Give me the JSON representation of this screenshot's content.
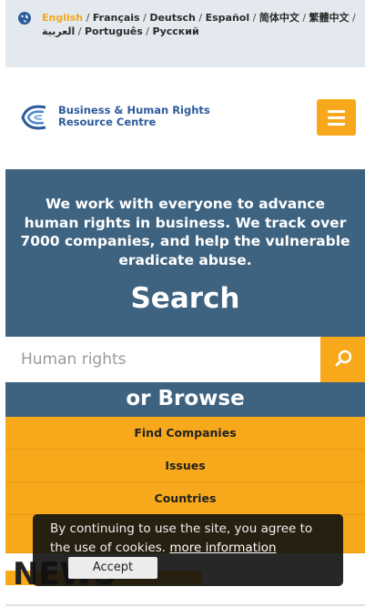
{
  "language_bar": {
    "current": "English",
    "languages": [
      "Français",
      "Deutsch",
      "Español",
      "简体中文",
      "繁體中文",
      "العربية",
      "Português",
      "Русский"
    ],
    "icon": "globe-icon"
  },
  "header": {
    "logo_line1": "Business & Human Rights",
    "logo_line2": "Resource Centre",
    "menu_icon": "hamburger-menu-icon",
    "accent_color": "#f7a91b",
    "brand_color": "#2c5b9c"
  },
  "hero": {
    "text": "We work with everyone to advance human rights in business. We track over 7000 companies, and help the vulnerable eradicate abuse.",
    "title": "Search",
    "background_color": "#3e6381"
  },
  "search": {
    "placeholder": "Human rights",
    "icon": "search-icon"
  },
  "browse": {
    "title": "or Browse",
    "items": [
      {
        "label": "Find Companies"
      },
      {
        "label": "Issues"
      },
      {
        "label": "Countries"
      },
      {
        "label": ""
      }
    ]
  },
  "news": {
    "title": "NEWS"
  },
  "cookie_banner": {
    "text": "By continuing to use the site, you agree to the use of cookies.",
    "link_label": "more information",
    "accept_label": "Accept"
  }
}
